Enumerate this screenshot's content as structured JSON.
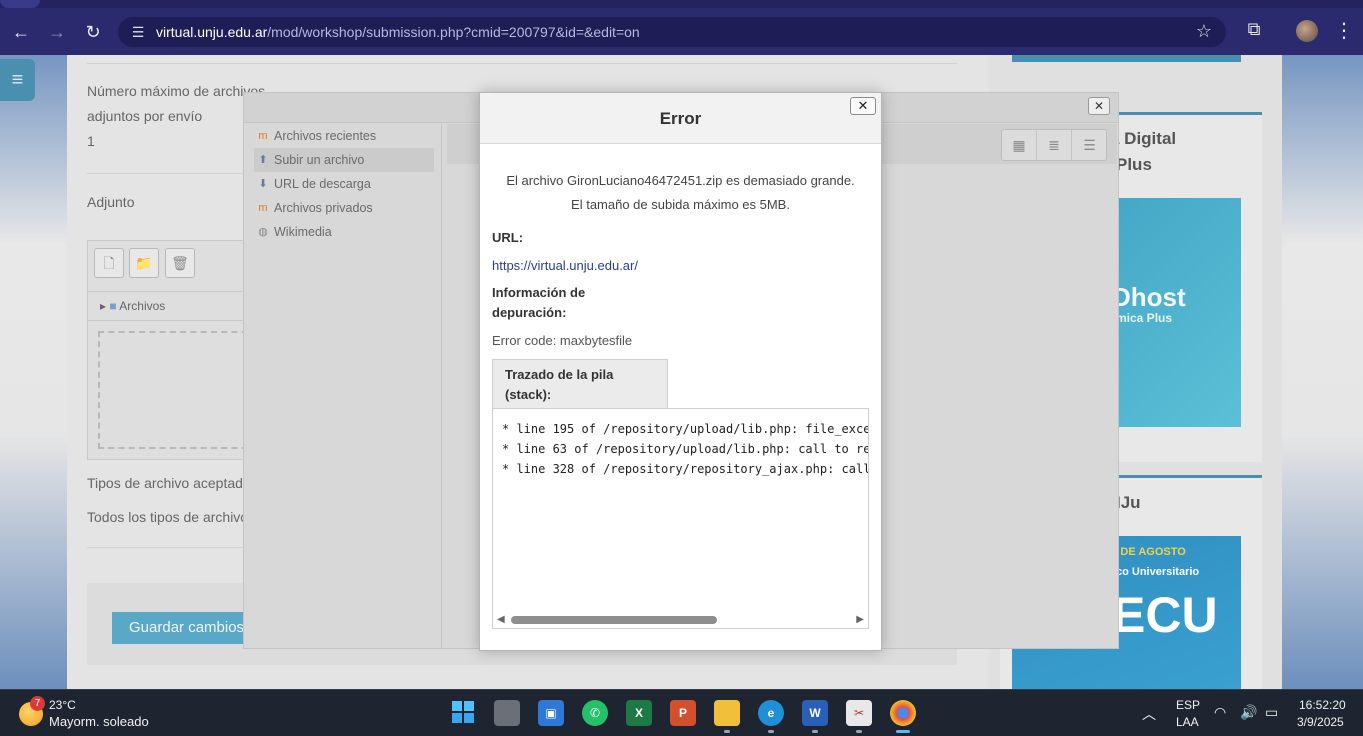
{
  "browser": {
    "url_host": "virtual.unju.edu.ar",
    "url_path": "/mod/workshop/submission.php?cmid=200797&id=&edit=on",
    "icons": [
      "back-icon",
      "forward-icon",
      "reload-icon",
      "site-settings-icon",
      "bookmark-star-icon",
      "extensions-icon",
      "profile-avatar",
      "menu-kebab-icon"
    ]
  },
  "page": {
    "max_files_label_1": "Número máximo de archivos",
    "max_files_label_2": "adjuntos por envío",
    "max_files_value": "1",
    "attachment_label": "Adjunto",
    "folder_name": "Archivos",
    "accepted_types_label": "Tipos de archivo aceptados",
    "accepted_types_value": "Todos los tipos de archivo",
    "save_button": "Guardar cambios",
    "side_title_1a": "a Digital",
    "side_title_1b": "Plus",
    "ad1_text_big": "Dhost",
    "ad1_text_small": "mica Plus",
    "side_title_2": "IJu",
    "ad2_line1": "S DE AGOSTO",
    "ad2_line2": "co Universitario",
    "ad2_big": "ECU"
  },
  "picker": {
    "repositories": [
      {
        "label": "Archivos recientes",
        "icon": "moodle-icon"
      },
      {
        "label": "Subir un archivo",
        "icon": "upload-icon"
      },
      {
        "label": "URL de descarga",
        "icon": "url-icon"
      },
      {
        "label": "Archivos privados",
        "icon": "moodle-icon"
      },
      {
        "label": "Wikimedia",
        "icon": "wikimedia-icon"
      }
    ]
  },
  "error": {
    "title": "Error",
    "message_1": "El archivo GironLuciano46472451.zip es demasiado grande.",
    "message_2": "El tamaño de subida máximo es 5MB.",
    "url_label": "URL:",
    "url_value": "https://virtual.unju.edu.ar/",
    "debug_label_1": "Información de",
    "debug_label_2": "depuración:",
    "error_code": "Error code: maxbytesfile",
    "stack_label_1": "Trazado de la pila",
    "stack_label_2": "(stack):",
    "stack_lines": [
      "* line 195 of /repository/upload/lib.php: file_exce",
      "* line 63 of /repository/upload/lib.php: call to re",
      "* line 328 of /repository/repository_ajax.php: call"
    ],
    "close_symbol": "✕"
  },
  "taskbar": {
    "weather_badge": "7",
    "temperature": "23°C",
    "weather_desc": "Mayorm. soleado",
    "language_1": "ESP",
    "language_2": "LAA",
    "time": "16:52:20",
    "date": "3/9/2025"
  }
}
